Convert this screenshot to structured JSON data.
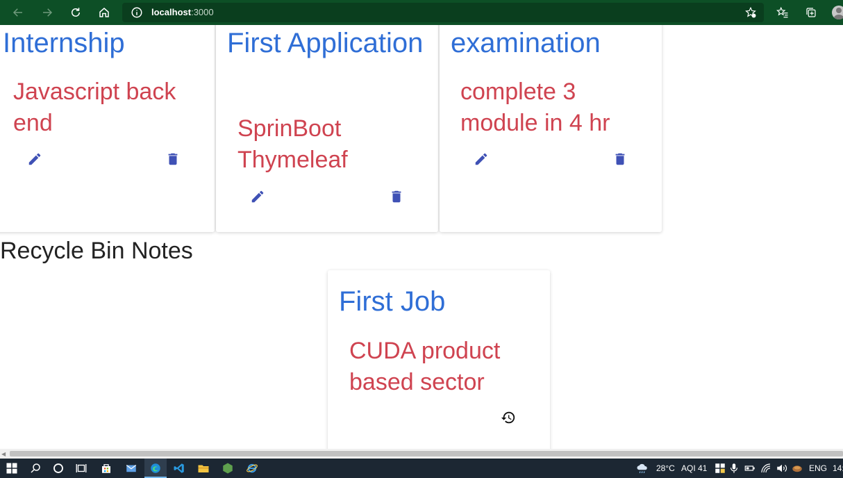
{
  "browser": {
    "url_host": "localhost",
    "url_port": ":3000",
    "icons": [
      "back-icon",
      "forward-icon",
      "refresh-icon",
      "home-icon",
      "info-icon",
      "add-favorite-icon",
      "favorites-icon",
      "collections-icon",
      "profile-avatar"
    ]
  },
  "notes": [
    {
      "title": "Internship",
      "content": "Javascript back end"
    },
    {
      "title": "First Application",
      "content": "SprinBoot Thymeleaf"
    },
    {
      "title": "examination",
      "content": "complete 3 module in 4 hr"
    }
  ],
  "recycle_bin": {
    "heading": "Recycle Bin Notes",
    "notes": [
      {
        "title": "First Job",
        "content": "CUDA product based sector"
      }
    ]
  },
  "colors": {
    "title": "#2f6ed6",
    "content": "#cf4350",
    "icon": "#3f51b5",
    "toolbar": "#0d4f26"
  },
  "taskbar": {
    "temperature": "28°C",
    "aqi": "AQI 41",
    "language": "ENG",
    "clock": "14:"
  }
}
